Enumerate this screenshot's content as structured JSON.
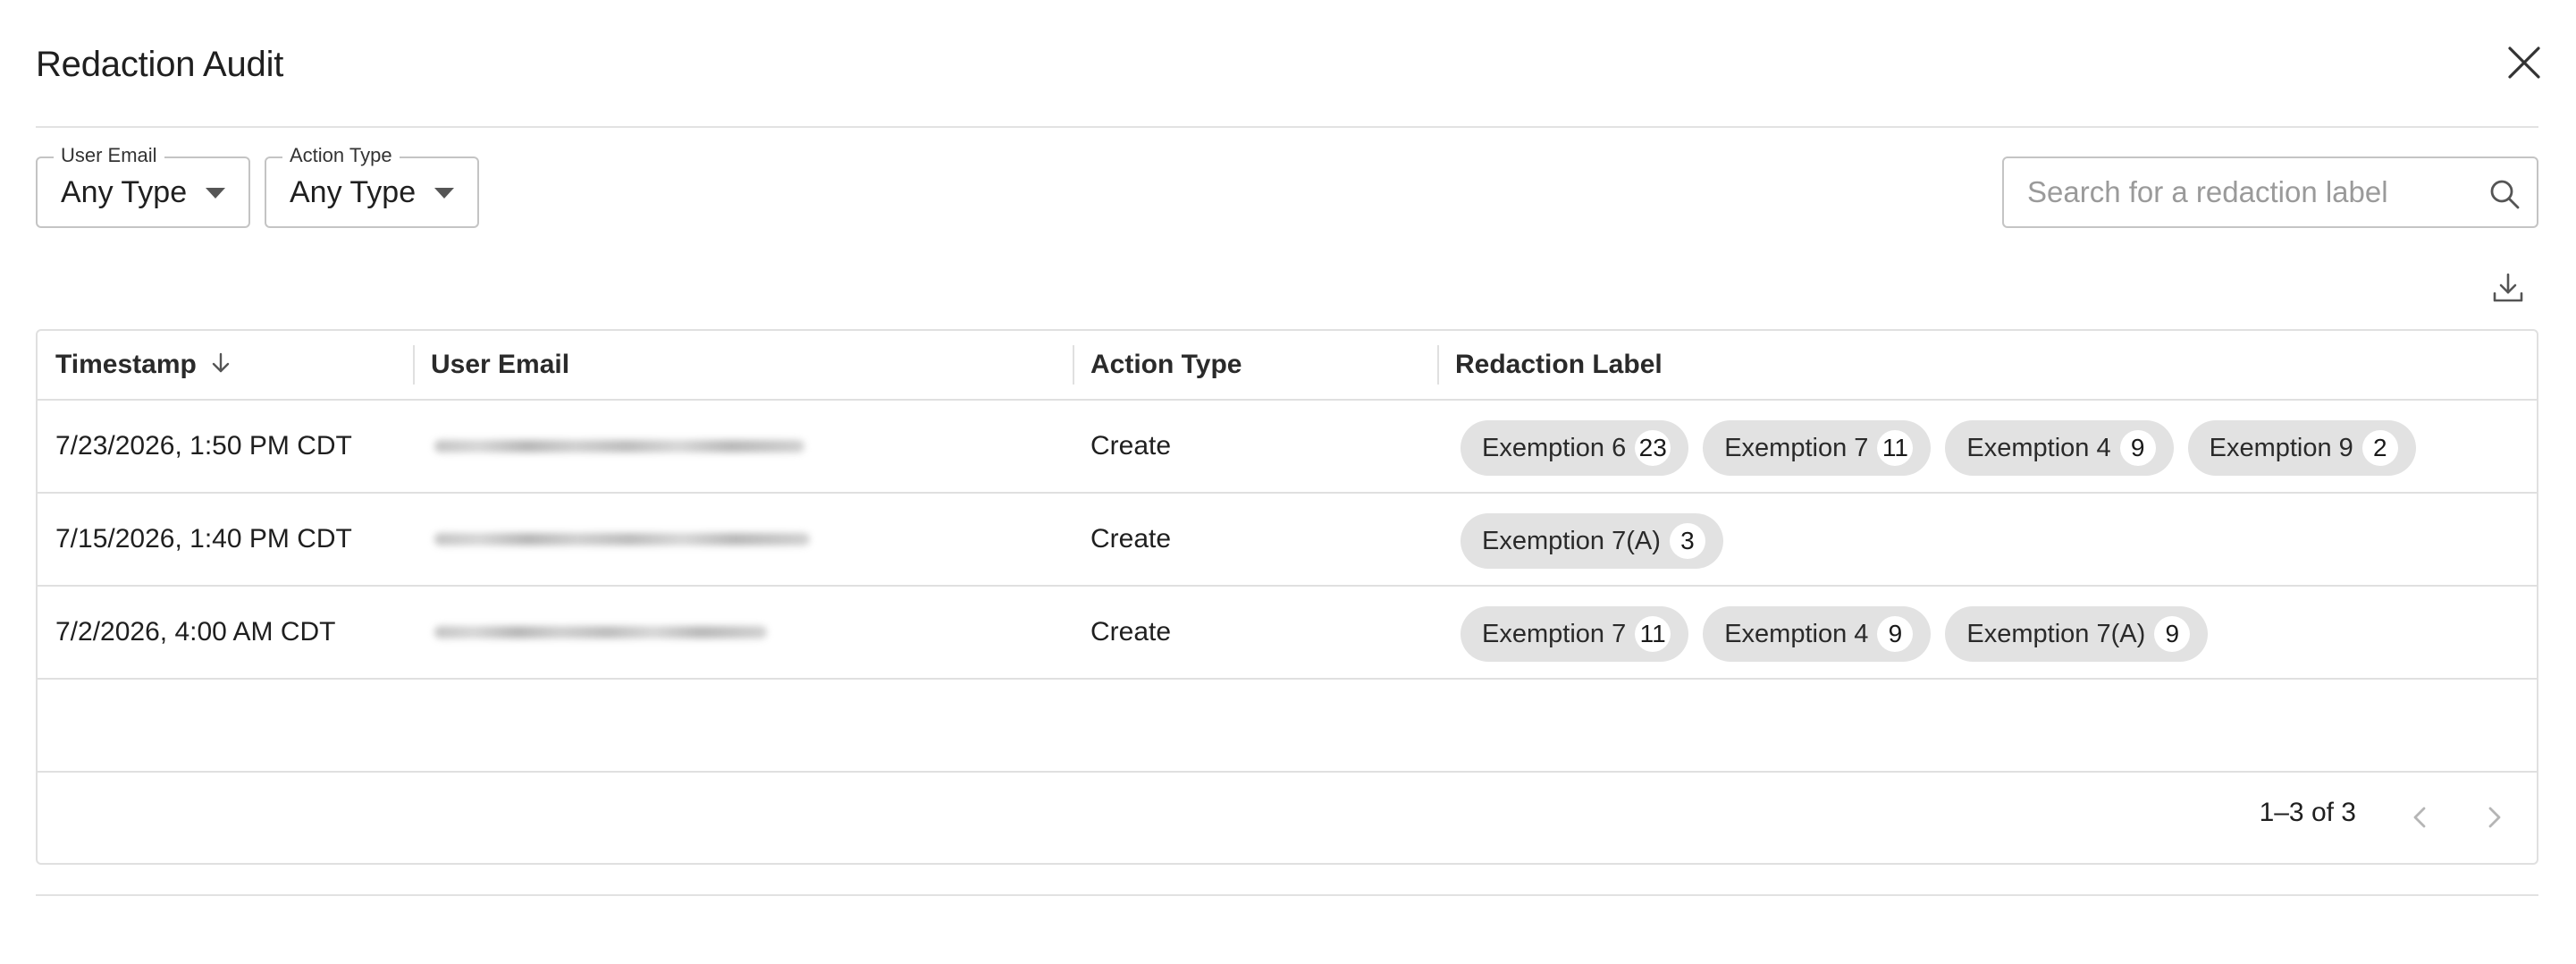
{
  "dialog": {
    "title": "Redaction Audit"
  },
  "filters": {
    "user_email": {
      "label": "User Email",
      "value": "Any Type"
    },
    "action_type": {
      "label": "Action Type",
      "value": "Any Type"
    },
    "search": {
      "placeholder": "Search for a redaction label",
      "value": ""
    }
  },
  "icons": {
    "close": "close-icon",
    "search": "search-icon",
    "download": "download-icon",
    "sort": "arrow-down-icon",
    "prev": "chevron-left-icon",
    "next": "chevron-right-icon",
    "dropdown": "caret-down-icon"
  },
  "table": {
    "columns": [
      "Timestamp",
      "User Email",
      "Action Type",
      "Redaction Label"
    ],
    "sorted_by": "Timestamp",
    "sort_direction": "descending",
    "rows": [
      {
        "timestamp": "7/23/2026, 1:50 PM CDT",
        "action": "Create",
        "labels": [
          {
            "name": "Exemption 6",
            "count": "23"
          },
          {
            "name": "Exemption 7",
            "count": "11"
          },
          {
            "name": "Exemption 4",
            "count": "9"
          },
          {
            "name": "Exemption 9",
            "count": "2"
          }
        ]
      },
      {
        "timestamp": "7/15/2026, 1:40 PM CDT",
        "action": "Create",
        "labels": [
          {
            "name": "Exemption 7(A)",
            "count": "3"
          }
        ]
      },
      {
        "timestamp": "7/2/2026, 4:00 AM CDT",
        "action": "Create",
        "labels": [
          {
            "name": "Exemption 7",
            "count": "11"
          },
          {
            "name": "Exemption 4",
            "count": "9"
          },
          {
            "name": "Exemption 7(A)",
            "count": "9"
          }
        ]
      }
    ]
  },
  "pagination": {
    "range": "1–3 of 3"
  },
  "colors": {
    "chip_bg": "#e2e2e2",
    "border": "#e0e0e0",
    "text": "#1f1f1f"
  }
}
